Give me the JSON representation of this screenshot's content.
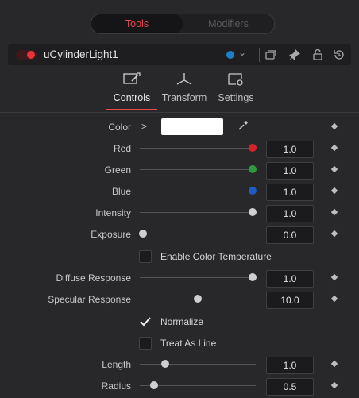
{
  "top_tabs": {
    "tools": "Tools",
    "modifiers": "Modifiers"
  },
  "node": {
    "name": "uCylinderLight1",
    "color_dot": "#1d7fc8",
    "enabled": true
  },
  "sub_tabs": {
    "controls": "Controls",
    "transform": "Transform",
    "settings": "Settings",
    "active": "Controls"
  },
  "params": {
    "color": {
      "label": "Color",
      "swatch": "#ffffff"
    },
    "red": {
      "label": "Red",
      "value": "1.0",
      "slider_fraction": 1.0,
      "knob_color": "#d4242a"
    },
    "green": {
      "label": "Green",
      "value": "1.0",
      "slider_fraction": 1.0,
      "knob_color": "#2a9a3a"
    },
    "blue": {
      "label": "Blue",
      "value": "1.0",
      "slider_fraction": 1.0,
      "knob_color": "#1c5cc4"
    },
    "intensity": {
      "label": "Intensity",
      "value": "1.0",
      "slider_fraction": 1.0
    },
    "exposure": {
      "label": "Exposure",
      "value": "0.0",
      "slider_fraction": 0.0
    },
    "enable_color_temperature": {
      "label": "Enable Color Temperature",
      "checked": false
    },
    "diffuse_response": {
      "label": "Diffuse Response",
      "value": "1.0",
      "slider_fraction": 1.0
    },
    "specular_response": {
      "label": "Specular Response",
      "value": "10.0",
      "slider_fraction": 0.5
    },
    "normalize": {
      "label": "Normalize",
      "checked": true
    },
    "treat_as_line": {
      "label": "Treat As Line",
      "checked": false
    },
    "length": {
      "label": "Length",
      "value": "1.0",
      "slider_fraction": 0.2
    },
    "radius": {
      "label": "Radius",
      "value": "0.5",
      "slider_fraction": 0.1
    }
  },
  "icons": {
    "header": [
      "toggle-icon",
      "color-dot",
      "chevron-down-icon",
      "versions-icon",
      "pin-icon",
      "lock-icon",
      "reset-icon"
    ],
    "row": [
      "expand-chevron-icon",
      "eyedropper-icon",
      "keyframe-diamond-icon"
    ]
  },
  "colors": {
    "accent": "#e8474c",
    "background": "#28282a"
  }
}
